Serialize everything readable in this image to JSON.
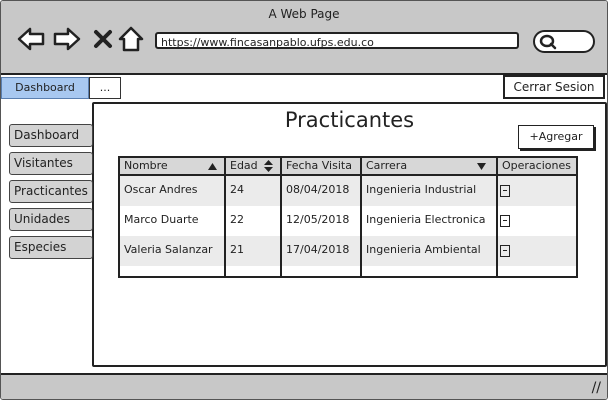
{
  "window": {
    "title": "A Web Page"
  },
  "browser": {
    "url": "https://www.fincasanpablo.ufps.edu.co",
    "icons": [
      "back-arrow-icon",
      "forward-arrow-icon",
      "close-x-icon",
      "home-icon",
      "search-icon"
    ]
  },
  "topnav": {
    "dashboard_tab": "Dashboard",
    "more_tab": "...",
    "logout": "Cerrar Sesion"
  },
  "sidebar": {
    "items": [
      {
        "label": "Dashboard"
      },
      {
        "label": "Visitantes"
      },
      {
        "label": "Practicantes"
      },
      {
        "label": "Unidades"
      },
      {
        "label": "Especies"
      }
    ]
  },
  "main": {
    "title": "Practicantes",
    "add_button": "+Agregar",
    "table": {
      "columns": [
        "Nombre",
        "Edad",
        "Fecha Visita",
        "Carrera",
        "Operaciones"
      ],
      "rows": [
        [
          "Oscar Andres",
          "24",
          "08/04/2018",
          "Ingenieria Industrial"
        ],
        [
          "Marco Duarte",
          "22",
          "12/05/2018",
          "Ingenieria Electronica"
        ],
        [
          "Valeria Salanzar",
          "21",
          "17/04/2018",
          "Ingenieria Ambiental"
        ]
      ]
    }
  },
  "colors": {
    "chrome": "#c8c8c8",
    "active_tab": "#a8c8f0",
    "sidebar_item": "#d3d3d3",
    "table_header": "#d7d7d7"
  }
}
